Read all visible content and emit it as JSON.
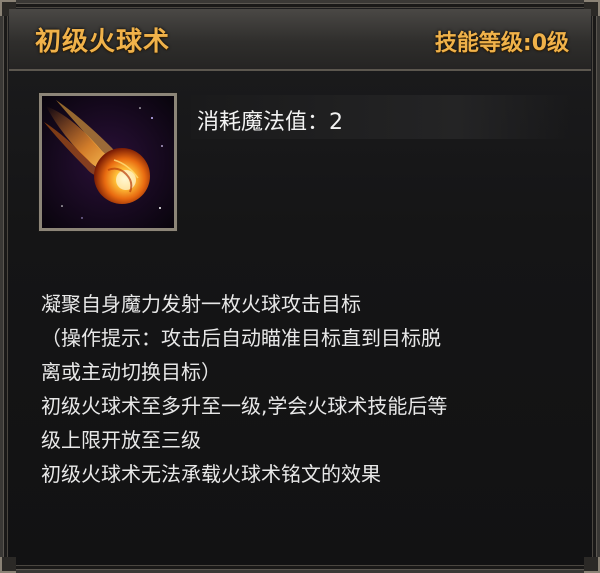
{
  "skill": {
    "name": "初级火球术",
    "level_text": "技能等级:0级",
    "cost_text": "消耗魔法值：2",
    "icon": "fireball-icon"
  },
  "description": [
    "凝聚自身魔力发射一枚火球攻击目标",
    "（操作提示：攻击后自动瞄准目标直到目标脱",
    "离或主动切换目标）",
    "初级火球术至多升至一级,学会火球术技能后等",
    "级上限开放至三级",
    "初级火球术无法承载火球术铭文的效果"
  ],
  "colors": {
    "title": "#f0b24a",
    "text": "#e8e8e8",
    "panel": "#151516"
  }
}
